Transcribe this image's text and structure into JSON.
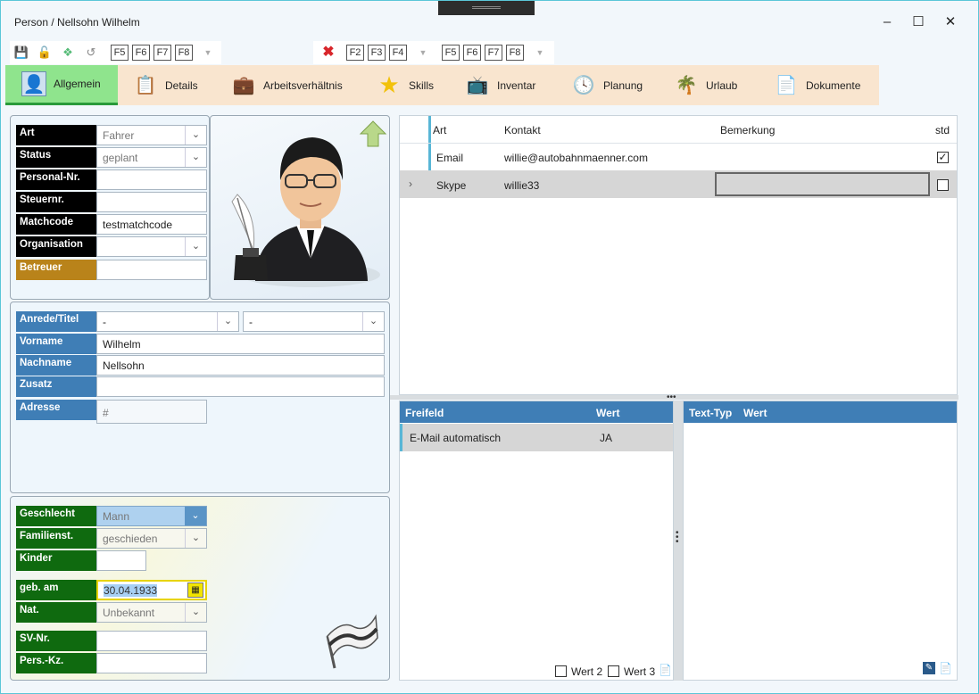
{
  "window": {
    "title": "Person / Nellsohn Wilhelm"
  },
  "toolbar": {
    "group1_icons": [
      "save-icon",
      "unlock-icon",
      "tool-icon",
      "refresh-icon"
    ],
    "group1_keys": [
      "F5",
      "F6",
      "F7",
      "F8"
    ],
    "group2_keys": [
      "F2",
      "F3",
      "F4"
    ],
    "group3_keys": [
      "F5",
      "F6",
      "F7",
      "F8"
    ]
  },
  "tabs": [
    {
      "label": "Allgemein",
      "icon": "person-icon",
      "active": true
    },
    {
      "label": "Details",
      "icon": "details-icon"
    },
    {
      "label": "Arbeitsverhältnis",
      "icon": "briefcase-icon"
    },
    {
      "label": "Skills",
      "icon": "star-icon"
    },
    {
      "label": "Inventar",
      "icon": "device-icon"
    },
    {
      "label": "Planung",
      "icon": "clock-icon"
    },
    {
      "label": "Urlaub",
      "icon": "vacation-icon"
    },
    {
      "label": "Dokumente",
      "icon": "document-icon"
    }
  ],
  "general": {
    "art": {
      "label": "Art",
      "value": "Fahrer"
    },
    "status": {
      "label": "Status",
      "value": "geplant"
    },
    "personal_nr": {
      "label": "Personal-Nr.",
      "value": ""
    },
    "steuernr": {
      "label": "Steuernr.",
      "value": ""
    },
    "matchcode": {
      "label": "Matchcode",
      "value": "testmatchcode"
    },
    "organisation": {
      "label": "Organisation",
      "value": ""
    },
    "betreuer": {
      "label": "Betreuer",
      "value": ""
    }
  },
  "name": {
    "anrede": {
      "label": "Anrede/Titel",
      "value1": "-",
      "value2": "-"
    },
    "vorname": {
      "label": "Vorname",
      "value": "Wilhelm"
    },
    "nachname": {
      "label": "Nachname",
      "value": "Nellsohn"
    },
    "zusatz": {
      "label": "Zusatz",
      "value": ""
    },
    "adresse": {
      "label": "Adresse",
      "value": "#"
    }
  },
  "personal": {
    "geschlecht": {
      "label": "Geschlecht",
      "value": "Mann"
    },
    "familienstand": {
      "label": "Familienst.",
      "value": "geschieden"
    },
    "kinder": {
      "label": "Kinder",
      "value": ""
    },
    "geb_am": {
      "label": "geb. am",
      "value": "30.04.1933"
    },
    "nat": {
      "label": "Nat.",
      "value": "Unbekannt"
    },
    "sv_nr": {
      "label": "SV-Nr.",
      "value": ""
    },
    "pers_kz": {
      "label": "Pers.-Kz.",
      "value": ""
    }
  },
  "contacts": {
    "columns": [
      "Art",
      "Kontakt",
      "Bemerkung",
      "std"
    ],
    "rows": [
      {
        "art": "Email",
        "kontakt": "willie@autobahnmaenner.com",
        "bemerkung": "",
        "std": true
      },
      {
        "art": "Skype",
        "kontakt": "willie33",
        "bemerkung": "",
        "std": false
      }
    ]
  },
  "freifeld": {
    "columns": [
      "Freifeld",
      "Wert"
    ],
    "rows": [
      {
        "freifeld": "E-Mail automatisch",
        "wert": "JA"
      }
    ],
    "wert2_label": "Wert 2",
    "wert3_label": "Wert 3"
  },
  "texttyp": {
    "columns": [
      "Text-Typ",
      "Wert"
    ]
  }
}
